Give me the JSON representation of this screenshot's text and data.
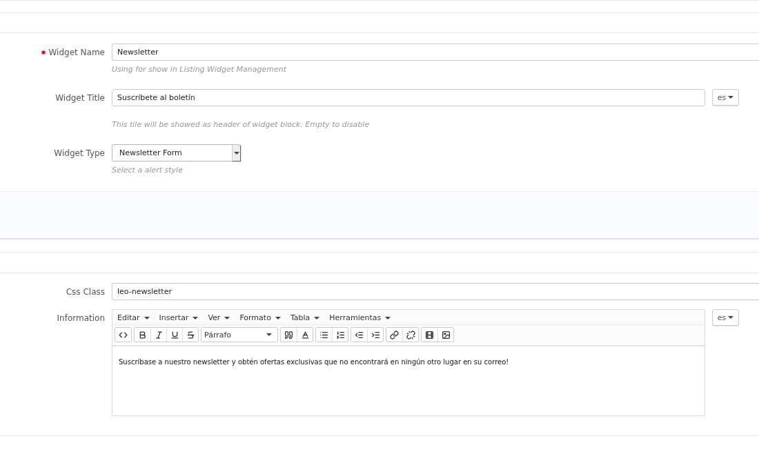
{
  "general": {
    "fields": [
      {
        "kind": "text",
        "label": "Widget Name",
        "required": true,
        "value": "Newsletter",
        "help": "Using for show in Listing Widget Management"
      },
      {
        "kind": "text",
        "label": "Widget Title",
        "required": false,
        "value": "Suscríbete al boletín",
        "help": "This tile will be showed as header of widget block. Empty to disable",
        "lang": "es"
      },
      {
        "kind": "select",
        "label": "Widget Type",
        "required": false,
        "value": "Newsletter Form",
        "help": "Select a alert style"
      }
    ]
  },
  "content": {
    "fields": [
      {
        "kind": "text",
        "label": "Css Class",
        "required": false,
        "value": "leo-newsletter"
      },
      {
        "kind": "editor",
        "label": "Information",
        "required": false,
        "lang": "es",
        "menu": [
          "Editar",
          "Insertar",
          "Ver",
          "Formato",
          "Tabla",
          "Herramientas"
        ],
        "format": "Párrafo",
        "body": "Suscríbase a nuestro newsletter y obtén ofertas exclusivas que no encontrará en ningún otro lugar en su correo!"
      }
    ]
  }
}
